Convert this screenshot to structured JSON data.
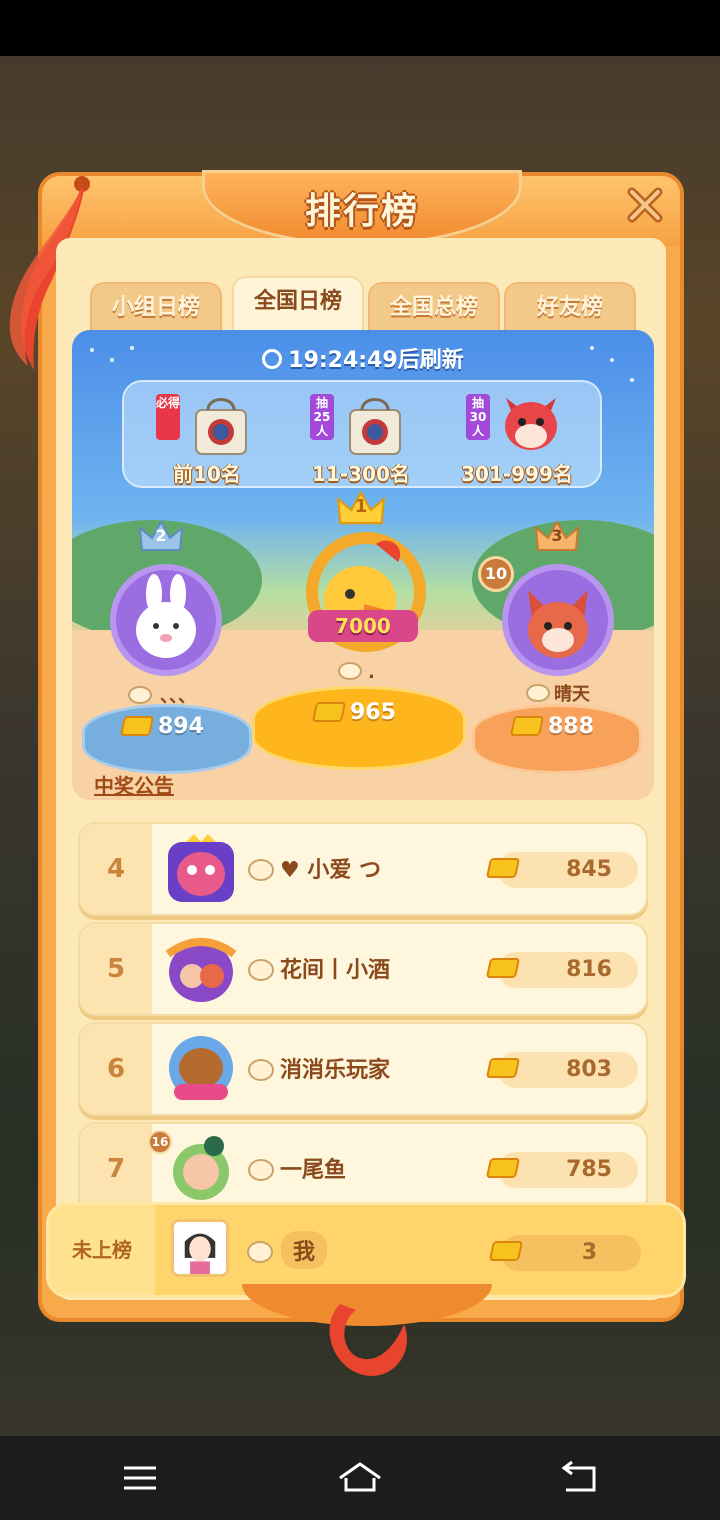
{
  "panel": {
    "title": "排行榜"
  },
  "tabs": [
    {
      "label": "小组日榜",
      "active": false
    },
    {
      "label": "全国日榜",
      "active": true
    },
    {
      "label": "全国总榜",
      "active": false
    },
    {
      "label": "好友榜",
      "active": false
    }
  ],
  "banner": {
    "timer": "19:24:49后刷新",
    "rewards": [
      {
        "tag": "必得",
        "label": "前10名",
        "tag_color": "#e8374a",
        "icon": "gift-bag-icon"
      },
      {
        "tag": "抽25人",
        "label": "11-300名",
        "tag_color": "#a24ad9",
        "icon": "gift-bag-icon"
      },
      {
        "tag": "抽30人",
        "label": "301-999名",
        "tag_color": "#a24ad9",
        "icon": "fox-plush-icon"
      }
    ]
  },
  "top3": [
    {
      "rank": "1",
      "name": ".",
      "score": "965",
      "badge": "7000"
    },
    {
      "rank": "2",
      "name": "、、、",
      "score": "894"
    },
    {
      "rank": "3",
      "name": "晴天",
      "score": "888",
      "level": "10"
    }
  ],
  "announcement": "中奖公告",
  "list": [
    {
      "rank": "4",
      "name": "♥ 小爱 つ",
      "score": "845"
    },
    {
      "rank": "5",
      "name": "花间丨小酒",
      "score": "816"
    },
    {
      "rank": "6",
      "name": "消消乐玩家",
      "score": "803"
    },
    {
      "rank": "7",
      "name": "一尾鱼",
      "score": "785",
      "level": "16"
    }
  ],
  "me": {
    "rank": "未上榜",
    "name": "我",
    "score": "3"
  },
  "colors": {
    "panel_orange": "#f8a94a",
    "panel_cream": "#fde9b8",
    "gold": "#f8c21e",
    "text_brown": "#8a4a1c"
  }
}
